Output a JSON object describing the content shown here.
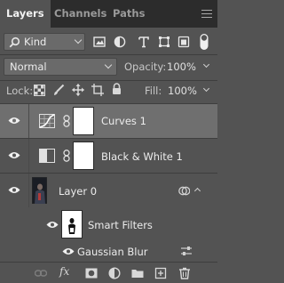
{
  "tabs": [
    {
      "label": "Layers",
      "active": true
    },
    {
      "label": "Channels",
      "active": false
    },
    {
      "label": "Paths",
      "active": false
    }
  ],
  "filter": {
    "kind_label": "Kind"
  },
  "blend": {
    "mode": "Normal",
    "opacity_label": "Opacity:",
    "opacity_value": "100%"
  },
  "lock": {
    "label": "Lock:",
    "fill_label": "Fill:",
    "fill_value": "100%"
  },
  "layers": [
    {
      "name": "Curves 1",
      "selected": true
    },
    {
      "name": "Black & White 1",
      "selected": false
    },
    {
      "name": "Layer 0",
      "selected": false
    }
  ],
  "smart_filters": {
    "label": "Smart Filters",
    "filters": [
      "Gaussian Blur"
    ]
  },
  "bottom_toolbar": {
    "fx_label": "fx"
  },
  "colors": {
    "panel_bg": "#535353",
    "tab_bg": "#2c2c2c",
    "selected_row": "#6f6f6f"
  }
}
